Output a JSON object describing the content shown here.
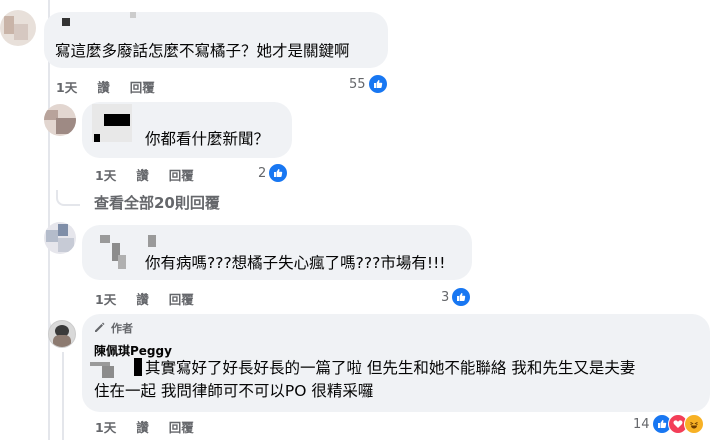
{
  "comments": [
    {
      "text": "寫這麼多廢話怎麼不寫橘子？她才是關鍵啊",
      "time": "1天",
      "like_label": "讚",
      "reply_label": "回覆",
      "reaction_count": "55",
      "reaction_icons": [
        "like-icon"
      ]
    },
    {
      "text": "你都看什麼新聞？",
      "time": "1天",
      "like_label": "讚",
      "reply_label": "回覆",
      "reaction_count": "2",
      "reaction_icons": [
        "like-icon"
      ]
    },
    {
      "text": "你有病嗎???想橘子失心瘋了嗎???市場有!!!",
      "time": "1天",
      "like_label": "讚",
      "reply_label": "回覆",
      "reaction_count": "3",
      "reaction_icons": [
        "like-icon"
      ]
    },
    {
      "author_badge": "作者",
      "author": "陳佩琪Peggy",
      "line1": "其實寫好了好長好長的一篇了啦 但先生和她不能聯絡 我和先生又是夫妻",
      "line2": "住在一起 我問律師可不可以PO 很精采囉",
      "time": "1天",
      "like_label": "讚",
      "reply_label": "回覆",
      "reaction_count": "14",
      "reaction_icons": [
        "like-icon",
        "love-icon",
        "haha-icon"
      ]
    }
  ],
  "view_more_replies": "查看全部20則回覆",
  "colors": {
    "bubble": "#f0f2f5",
    "text": "#050505",
    "meta": "#65676b",
    "like": "#1877f2",
    "love": "#f33e58",
    "haha": "#f7b125"
  }
}
